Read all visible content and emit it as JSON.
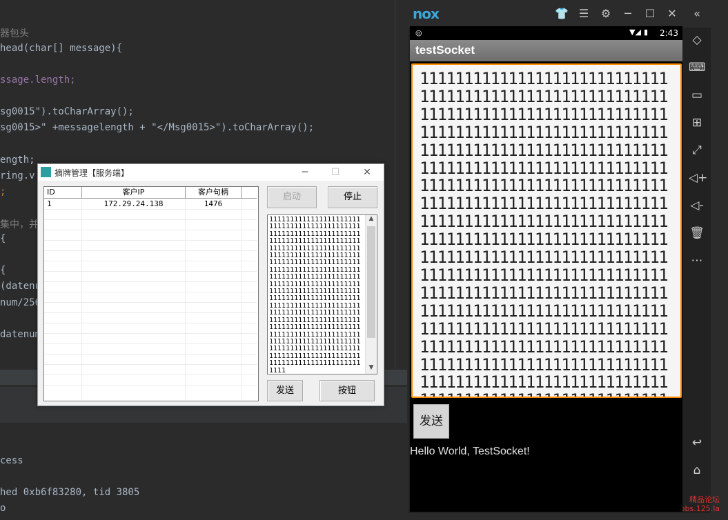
{
  "ide": {
    "lines": [
      "器包头",
      "head(char[] message){",
      "ssage.length;",
      "sg0015\").toCharArray();",
      "sg0015>\" +messagelength + \"</Msg0015>\").toCharArray();",
      "ength;",
      "ring.v",
      ";",
      "集中，并",
      "{",
      "{",
      "(datenu",
      "num/256",
      "datenum",
      "cess",
      "hed 0xb6f83280, tid 3805",
      "o"
    ]
  },
  "dialog": {
    "title": "摘牌管理【服务端】",
    "minimize": "─",
    "maximize": "☐",
    "close": "✕",
    "columns": [
      "ID",
      "客户IP",
      "客户句柄"
    ],
    "rows": [
      {
        "id": "1",
        "ip": "172.29.24.138",
        "handle": "1476"
      }
    ],
    "start_button": "启动",
    "stop_button": "停止",
    "send_button": "发送",
    "other_button": "按钮",
    "textbox_content": "1111111111111111111111111111111111111111111111111111111111111111111111111111111111111111111111111111111111111111111111111111111111111111111111111111111111111111111111111111111111111111111111111111111111111111111111111111111111111111111111111111111111111111111111111111111111111111111111111111111111111111111111111111111111111111111111111111111111111111111111111111111111111111111111111111111111111111111111111111111111111111111111111111111111111111111111111111111111"
  },
  "nox": {
    "logo": "nox",
    "status_time": "2:43",
    "app_title": "testSocket",
    "edit_content": "1111111111111111111111111111111111111111111111111111111111111111111111111111111111111111111111111111111111111111111111111111111111111111111111111111111111111111111111111111111111111111111111111111111111111111111111111111111111111111111111111111111111111111111111111111111111111111111111111111111111111111111111111111111111111111111111111111111111111111111111111111111111111111111111111111111111111111111111111111111111111111111111111111111111111111111111111111111111111111111111111111111111111111111111111111111111111111111111111111111111111",
    "send_button": "发送",
    "hello_text": "Hello World, TestSocket!",
    "watermark_1": "精品论坛",
    "watermark_2": "bbs.125.la"
  }
}
